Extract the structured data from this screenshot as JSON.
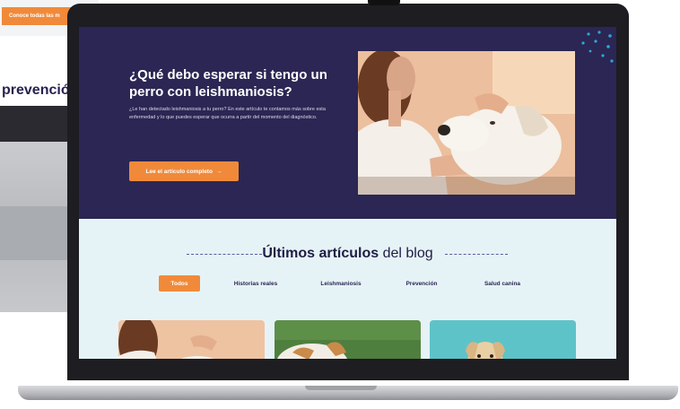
{
  "background_page": {
    "top_button_label": "Conoce todas las m",
    "heading": "prevenció"
  },
  "hero": {
    "title": "¿Qué debo esperar si tengo un perro con leishmaniosis?",
    "description": "¿Le han detectado leishmaniosis a tu perro? En este artículo te contamos más sobre esta enfermedad y lo que puedes esperar que ocurra a partir del momento del diagnóstico.",
    "cta_label": "Lee el artículo completo",
    "cta_arrow": "→",
    "image_icon": "woman-with-dog-photo"
  },
  "blog": {
    "heading_strong": "Últimos artículos",
    "heading_rest": " del blog",
    "filters": [
      {
        "label": "Todos",
        "active": true
      },
      {
        "label": "Historias reales",
        "active": false
      },
      {
        "label": "Leishmaniosis",
        "active": false
      },
      {
        "label": "Prevención",
        "active": false
      },
      {
        "label": "Salud canina",
        "active": false
      }
    ],
    "cards": [
      {
        "image_icon": "woman-with-dog-photo"
      },
      {
        "image_icon": "dog-on-grass-photo"
      },
      {
        "image_icon": "labrador-teal-photo"
      }
    ]
  },
  "colors": {
    "hero_bg": "#2b2653",
    "accent": "#f08a3a",
    "blog_bg": "#e6f3f6",
    "dots": "#29a9d6"
  }
}
